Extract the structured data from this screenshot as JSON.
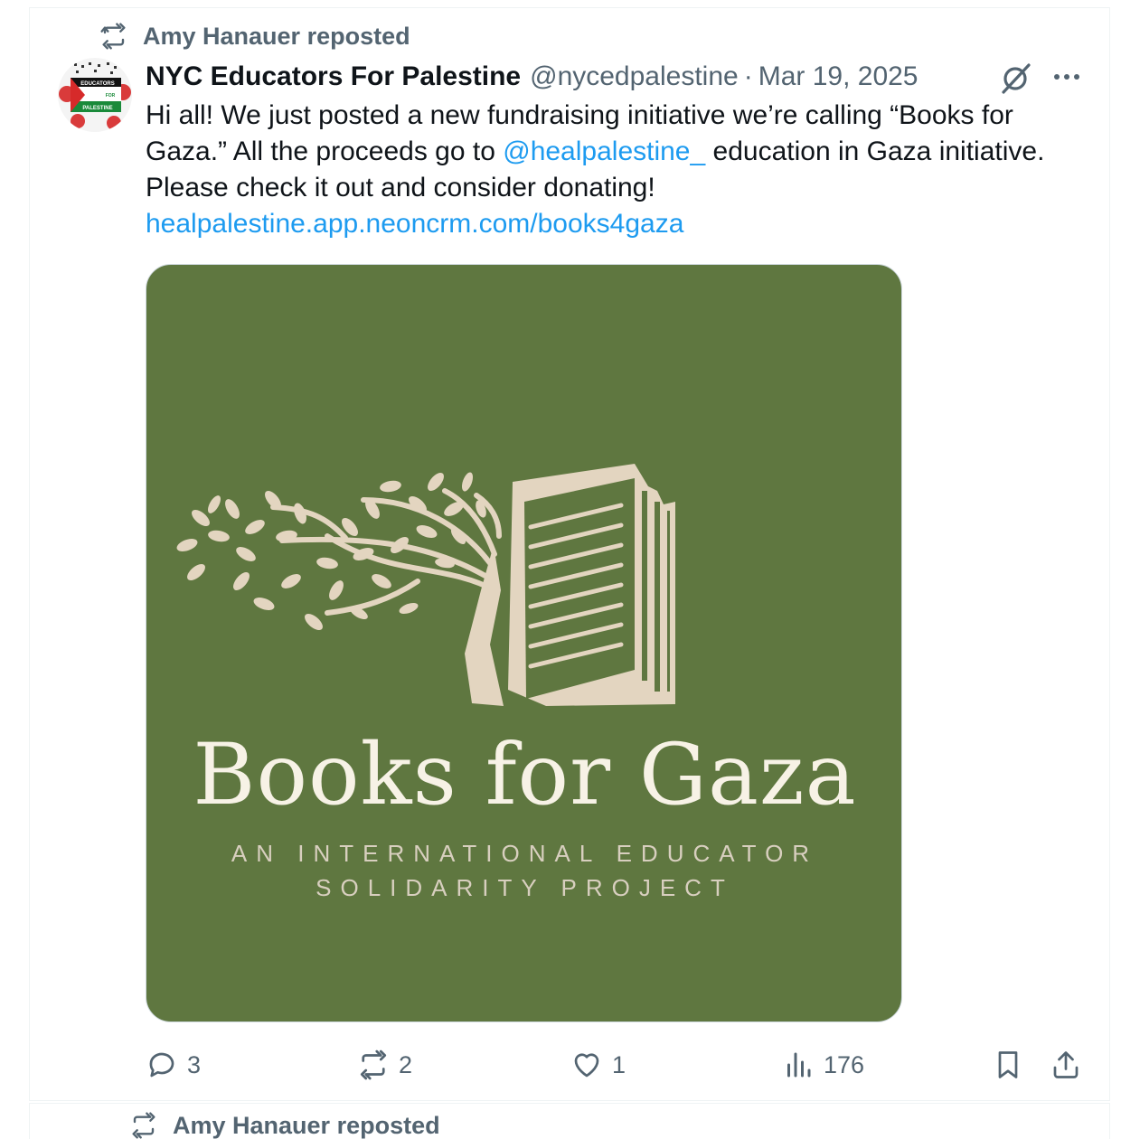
{
  "repost": {
    "label": "Amy Hanauer reposted"
  },
  "tweet": {
    "author_name": "NYC Educators For Palestine",
    "handle": "@nycedpalestine",
    "separator": "·",
    "date": "Mar 19, 2025",
    "avatar_text_1": "EDUCATORS",
    "avatar_text_2": "FOR",
    "avatar_text_3": "PALESTINE",
    "text_part1": "Hi all! We just posted a new fundraising initiative we’re calling “Books for Gaza.” All the proceeds go to ",
    "mention": "@healpalestine_",
    "text_part2": "  education in  Gaza initiative. Please check it out and consider donating!",
    "link": "healpalestine.app.neoncrm.com/books4gaza",
    "media": {
      "title": "Books for Gaza",
      "subtitle_line1": "AN INTERNATIONAL EDUCATOR",
      "subtitle_line2": "SOLIDARITY PROJECT",
      "background_color": "#5f7740",
      "artwork_color": "#e3d5c0"
    },
    "stats": {
      "replies": "3",
      "reposts": "2",
      "likes": "1",
      "views": "176"
    }
  },
  "next_repost": {
    "label": "Amy Hanauer reposted"
  },
  "colors": {
    "accent": "#1d9bf0",
    "muted": "#536471",
    "text": "#0f1419"
  },
  "icons": [
    "repost-icon",
    "grok-icon",
    "more-icon",
    "reply-icon",
    "retweet-icon",
    "like-icon",
    "views-icon",
    "bookmark-icon",
    "share-icon"
  ]
}
